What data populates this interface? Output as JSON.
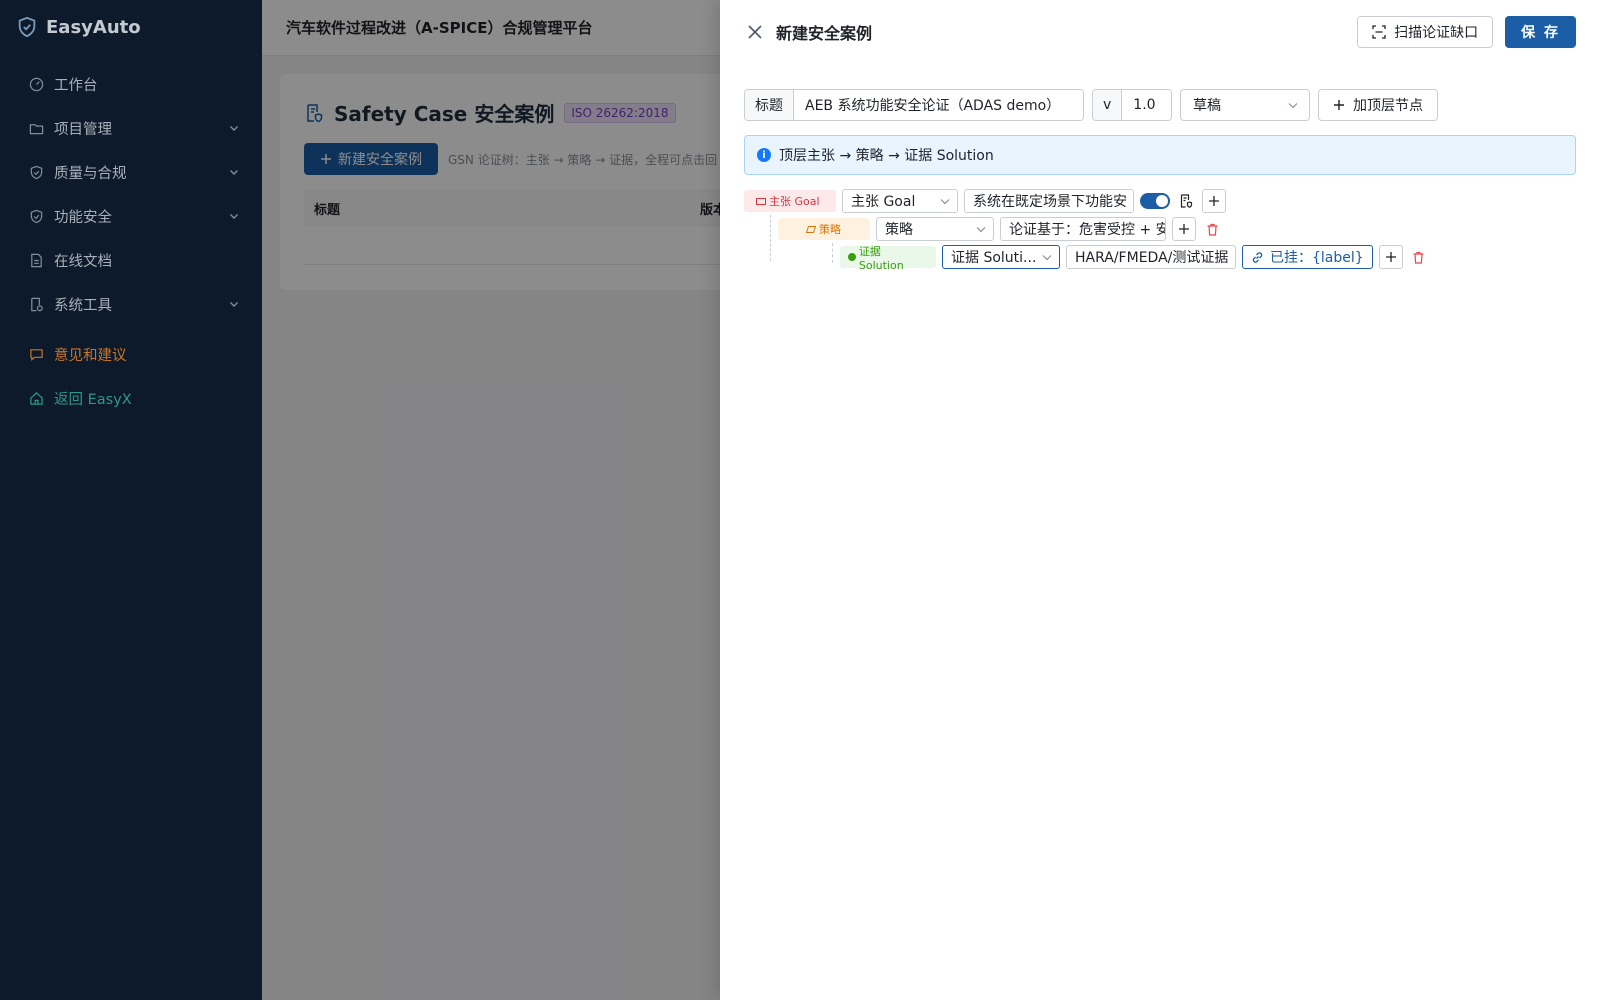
{
  "sidebar": {
    "brand": "EasyAuto",
    "items": [
      {
        "label": "工作台",
        "icon": "dashboard-icon",
        "expandable": false
      },
      {
        "label": "项目管理",
        "icon": "folder-icon",
        "expandable": true
      },
      {
        "label": "质量与合规",
        "icon": "shield-check-icon",
        "expandable": true
      },
      {
        "label": "功能安全",
        "icon": "shield-icon",
        "expandable": true
      },
      {
        "label": "在线文档",
        "icon": "document-icon",
        "expandable": false
      },
      {
        "label": "系统工具",
        "icon": "tool-icon",
        "expandable": true
      }
    ],
    "feedback": "意见和建议",
    "back": "返回 EasyX"
  },
  "header": {
    "platform_title": "汽车软件过程改进（A-SPICE）合规管理平台"
  },
  "page": {
    "title": "Safety Case 安全案例",
    "badge": "ISO 26262:2018",
    "new_button": "新建安全案例",
    "hint": "GSN 论证树：主张 → 策略 → 证据，全程可点击回",
    "columns": [
      "标题",
      "版本"
    ]
  },
  "drawer": {
    "title": "新建安全案例",
    "scan_button": "扫描论证缺口",
    "save_button": "保 存",
    "form": {
      "title_label": "标题",
      "title_value": "AEB 系统功能安全论证（ADAS demo）",
      "version_label": "v",
      "version_value": "1.0",
      "status_value": "草稿",
      "add_top_button": "加顶层节点"
    },
    "info": "顶层主张 → 策略 → 证据 Solution",
    "tree": {
      "goal": {
        "tag": "主张 Goal",
        "type": "主张 Goal",
        "text": "系统在既定场景下功能安"
      },
      "strategy": {
        "tag": "策略",
        "type": "策略",
        "text": "论证基于：危害受控 + 安"
      },
      "solution": {
        "tag": "证据 Solution",
        "type": "证据 Soluti...",
        "text": "HARA/FMEDA/测试证据",
        "link": "已挂：{label}"
      }
    }
  },
  "colors": {
    "sidebar_bg": "#0f1f33",
    "primary": "#1b5ea5",
    "goal": "#d9363e",
    "strategy": "#d97706",
    "solution": "#389e0d",
    "feedback": "#e98a2e",
    "back": "#35b3a2"
  }
}
